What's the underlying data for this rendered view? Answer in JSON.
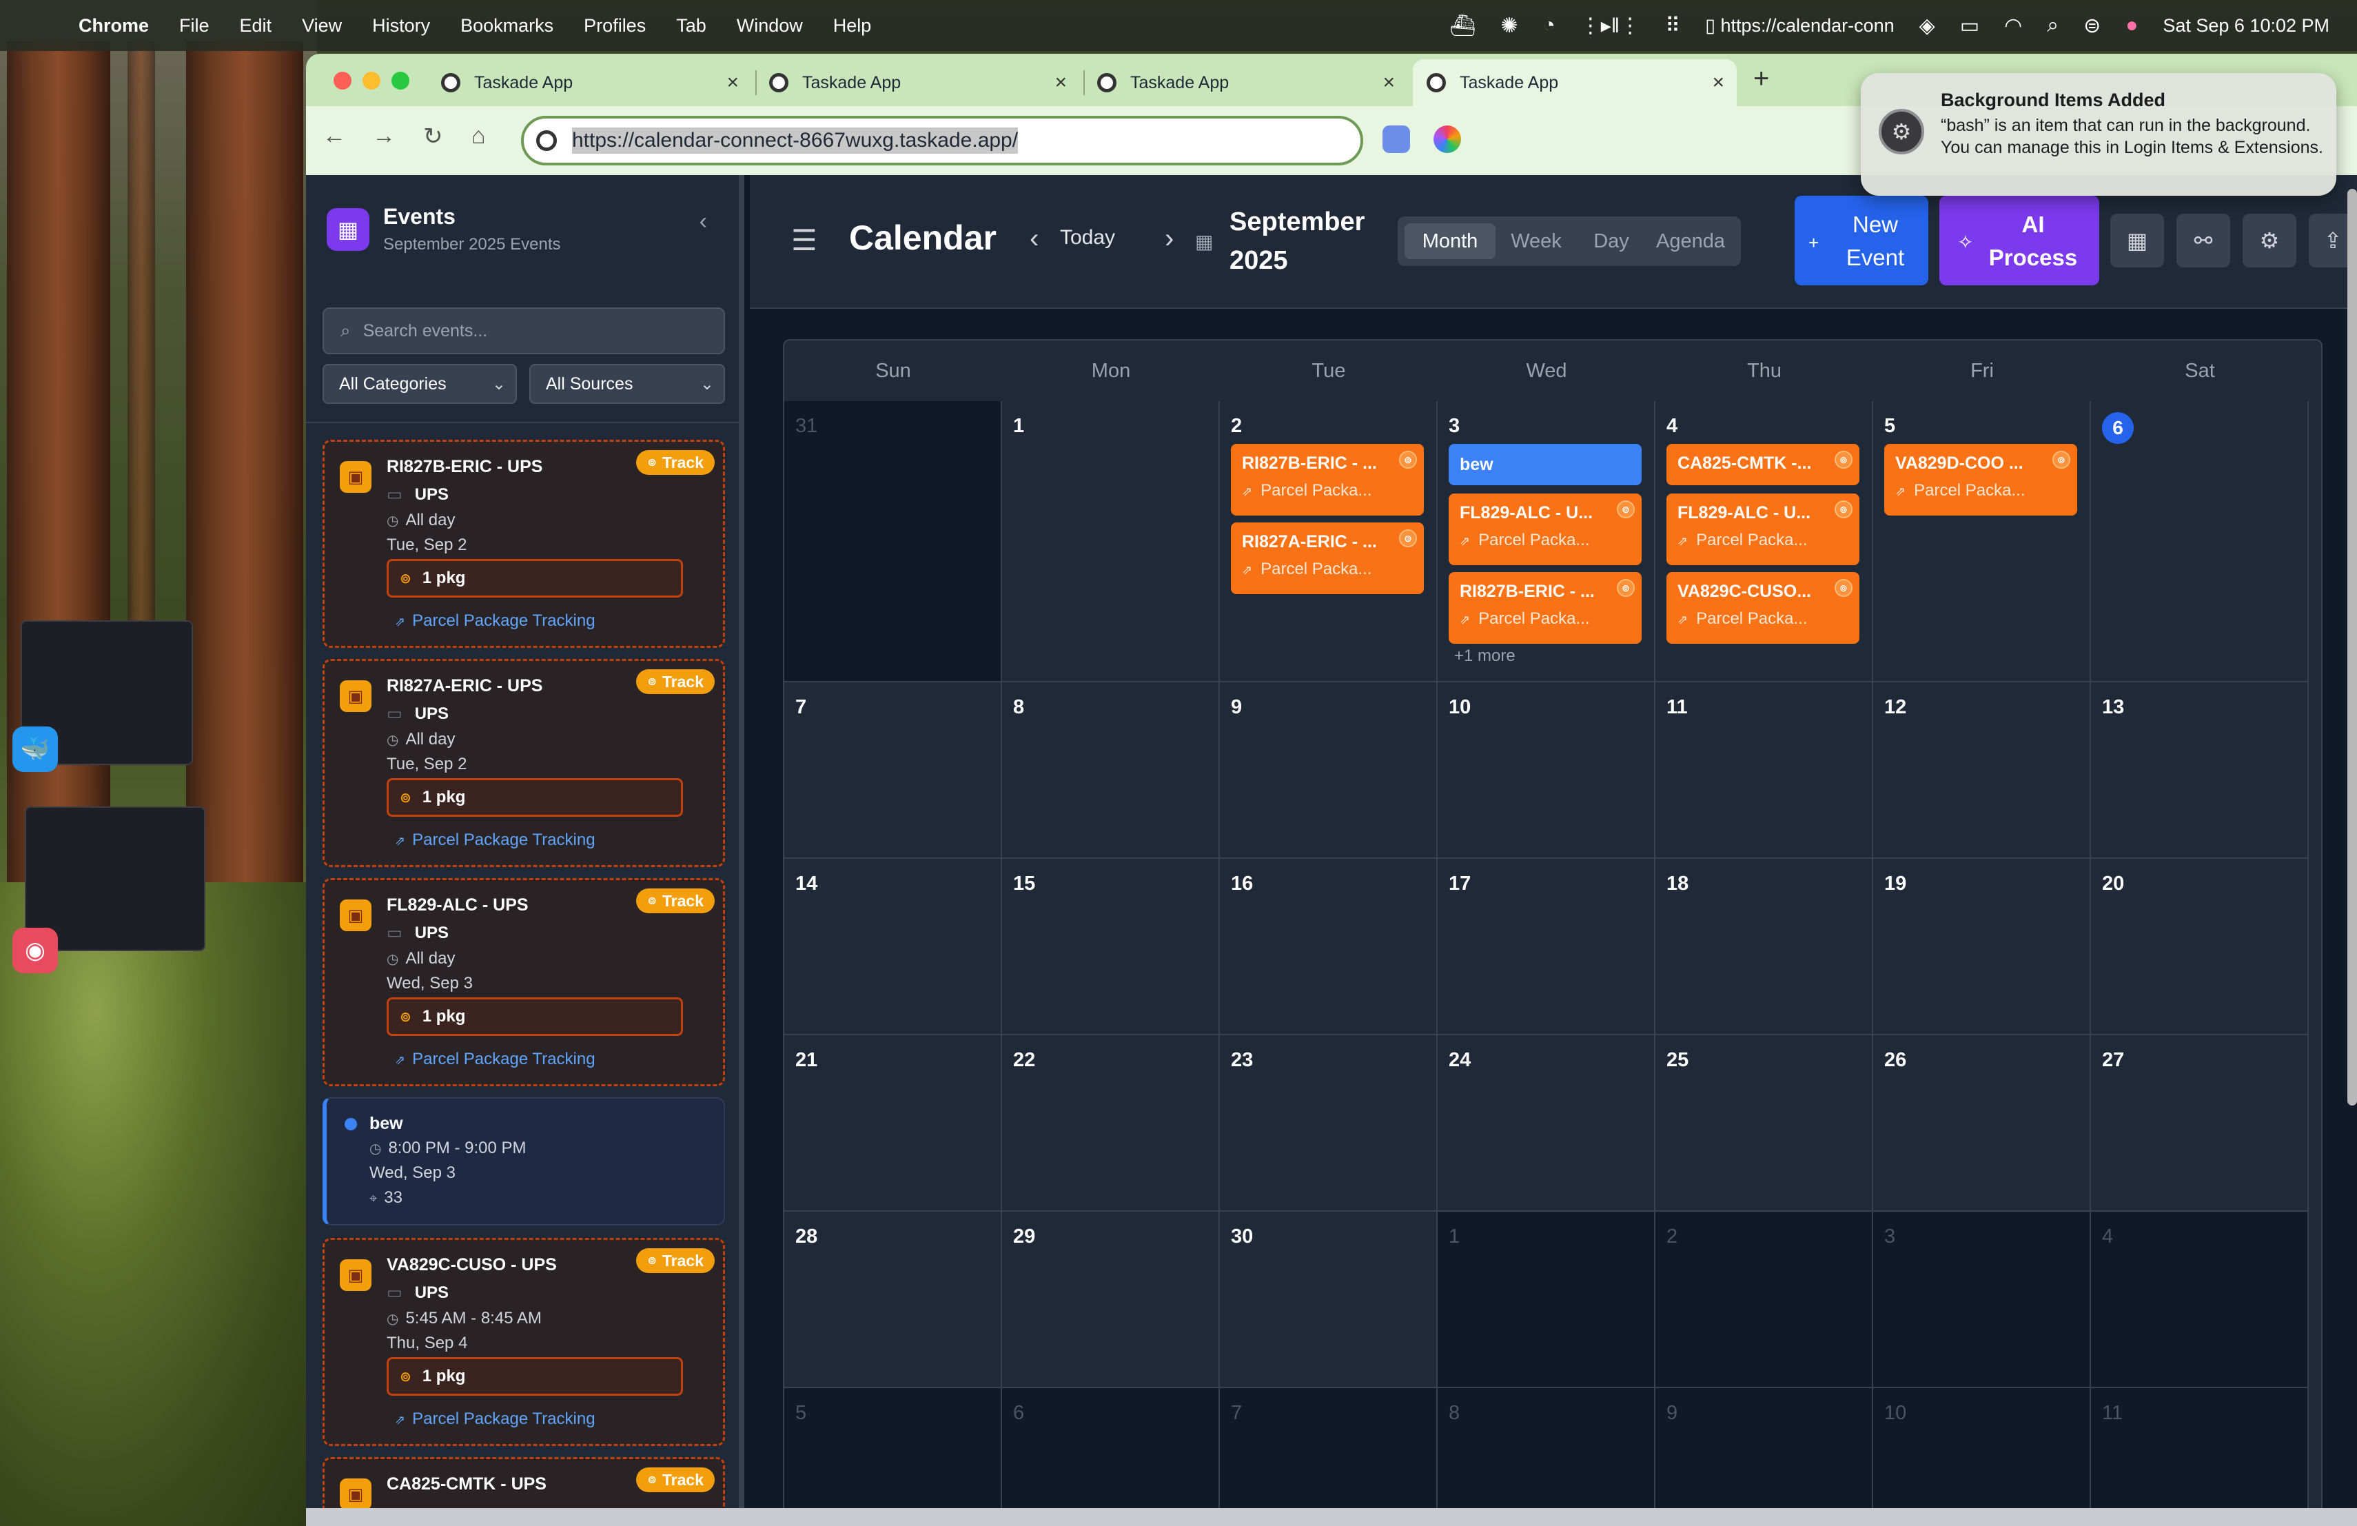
{
  "menubar": {
    "app": "Chrome",
    "items": [
      "File",
      "Edit",
      "View",
      "History",
      "Bookmarks",
      "Profiles",
      "Tab",
      "Window",
      "Help"
    ],
    "url_snippet": "https://calendar-conn",
    "datetime": "Sat Sep 6  10:02 PM"
  },
  "browser": {
    "tabs": [
      {
        "title": "Taskade App",
        "active": false
      },
      {
        "title": "Taskade App",
        "active": false
      },
      {
        "title": "Taskade App",
        "active": false
      },
      {
        "title": "Taskade App",
        "active": true
      }
    ],
    "url": "https://calendar-connect-8667wuxg.taskade.app/"
  },
  "notification": {
    "title": "Background Items Added",
    "body": "“bash” is an item that can run in the background. You can manage this in Login Items & Extensions."
  },
  "sidebar": {
    "title": "Events",
    "subtitle": "September 2025 Events",
    "search_placeholder": "Search events...",
    "category_filter": "All Categories",
    "source_filter": "All Sources",
    "cards": [
      {
        "type": "package",
        "title": "RI827B-ERIC - UPS",
        "carrier": "UPS",
        "time": "All day",
        "date": "Tue, Sep 2",
        "pkg": "1 pkg",
        "link": "Parcel Package Tracking",
        "track": "Track"
      },
      {
        "type": "package",
        "title": "RI827A-ERIC - UPS",
        "carrier": "UPS",
        "time": "All day",
        "date": "Tue, Sep 2",
        "pkg": "1 pkg",
        "link": "Parcel Package Tracking",
        "track": "Track"
      },
      {
        "type": "package",
        "title": "FL829-ALC - UPS",
        "carrier": "UPS",
        "time": "All day",
        "date": "Wed, Sep 3",
        "pkg": "1 pkg",
        "link": "Parcel Package Tracking",
        "track": "Track"
      },
      {
        "type": "event",
        "title": "bew",
        "time": "8:00 PM - 9:00 PM",
        "date": "Wed, Sep 3",
        "location": "33"
      },
      {
        "type": "package",
        "title": "VA829C-CUSO - UPS",
        "carrier": "UPS",
        "time": "5:45 AM - 8:45 AM",
        "date": "Thu, Sep 4",
        "pkg": "1 pkg",
        "link": "Parcel Package Tracking",
        "track": "Track"
      },
      {
        "type": "package",
        "title": "CA825-CMTK - UPS",
        "track": "Track"
      }
    ]
  },
  "calendar": {
    "title": "Calendar",
    "today_label": "Today",
    "month_label": "September 2025",
    "views": [
      "Month",
      "Week",
      "Day",
      "Agenda"
    ],
    "active_view": "Month",
    "new_event_label": "New Event",
    "ai_label": "AI Process",
    "weekdays": [
      "Sun",
      "Mon",
      "Tue",
      "Wed",
      "Thu",
      "Fri",
      "Sat"
    ],
    "weeks": [
      [
        "31",
        "1",
        "2",
        "3",
        "4",
        "5",
        "6"
      ],
      [
        "7",
        "8",
        "9",
        "10",
        "11",
        "12",
        "13"
      ],
      [
        "14",
        "15",
        "16",
        "17",
        "18",
        "19",
        "20"
      ],
      [
        "21",
        "22",
        "23",
        "24",
        "25",
        "26",
        "27"
      ],
      [
        "28",
        "29",
        "30",
        "1",
        "2",
        "3",
        "4"
      ],
      [
        "5",
        "6",
        "7",
        "8",
        "9",
        "10",
        "11"
      ]
    ],
    "today": "6",
    "events": {
      "tue_2": [
        {
          "title": "RI827B-ERIC - ...",
          "sub": "Parcel Packa..."
        },
        {
          "title": "RI827A-ERIC - ...",
          "sub": "Parcel Packa..."
        }
      ],
      "wed_3": [
        {
          "title": "bew"
        },
        {
          "title": "FL829-ALC - U...",
          "sub": "Parcel Packa..."
        },
        {
          "title": "RI827B-ERIC - ...",
          "sub": "Parcel Packa..."
        }
      ],
      "wed_3_more": "+1 more",
      "thu_4": [
        {
          "title": "CA825-CMTK -...",
          "sub": ""
        },
        {
          "title": "FL829-ALC - U...",
          "sub": "Parcel Packa..."
        },
        {
          "title": "VA829C-CUSO...",
          "sub": "Parcel Packa..."
        }
      ],
      "fri_5": [
        {
          "title": "VA829D-COO ...",
          "sub": "Parcel Packa..."
        }
      ]
    }
  }
}
